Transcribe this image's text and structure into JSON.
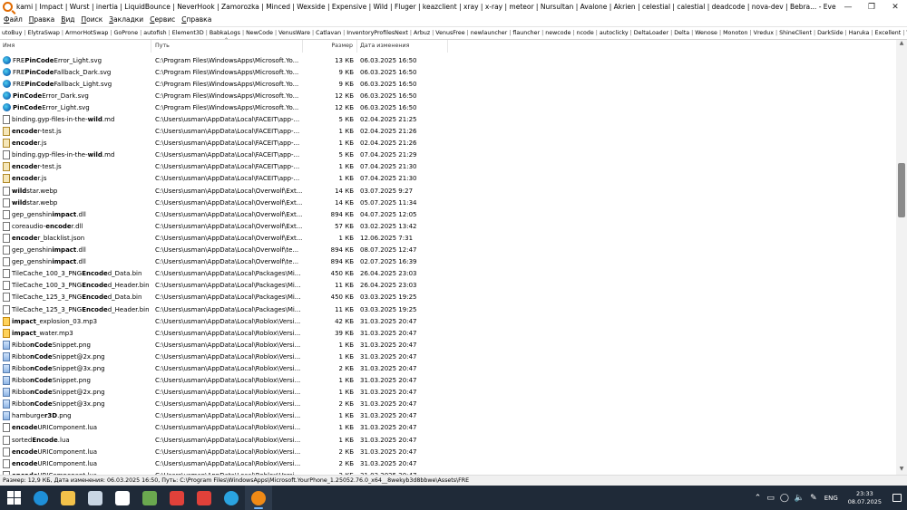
{
  "title": "kami | Impact | Wurst | inertia | LiquidBounce | NeverHook | Zamorozka | Minced | Wexside | Expensive | Wild | Fluger | keazclient | xray | x-ray | meteor | Nursultan | Avalone | Akrien | celestial | calestial | deadcode | nova-dev | Bebra... - Everything",
  "menu": [
    {
      "ul": "Ф",
      "rest": "айл"
    },
    {
      "ul": "П",
      "rest": "равка"
    },
    {
      "ul": "В",
      "rest": "ид"
    },
    {
      "ul": "П",
      "rest": "оиск"
    },
    {
      "ul": "З",
      "rest": "акладки"
    },
    {
      "ul": "С",
      "rest": "ервис"
    },
    {
      "ul": "С",
      "rest": "правка"
    }
  ],
  "bookmarks": [
    "utoBuy",
    "ElytraSwap",
    "ArmorHotSwap",
    "GoProne",
    "autofish",
    "Element3D",
    "BabkaLogs",
    "NewCode",
    "VenusWare",
    "Catlavan",
    "InventoryProfilesNext",
    "Arbuz",
    "VenusFree",
    "newlauncher",
    "flauncher",
    "newcode",
    "ncode",
    "autoclicky",
    "DeltaLoader",
    "Delta",
    "Wenose",
    "Monoton",
    "Vredux",
    "ShineClient",
    "DarkSide",
    "Haruka",
    "Excellent",
    "Venus"
  ],
  "columns": {
    "name": "Имя",
    "path": "Путь",
    "size": "Размер",
    "date": "Дата изменения"
  },
  "files": [
    {
      "icon": "edge",
      "pre": "FRE",
      "bold": "PinCode",
      "post": "Error_Light.svg",
      "path": "C:\\Program Files\\WindowsApps\\Microsoft.Yo...",
      "size": "13 КБ",
      "date": "06.03.2025 16:50"
    },
    {
      "icon": "edge",
      "pre": "FRE",
      "bold": "PinCode",
      "post": "Fallback_Dark.svg",
      "path": "C:\\Program Files\\WindowsApps\\Microsoft.Yo...",
      "size": "9 КБ",
      "date": "06.03.2025 16:50"
    },
    {
      "icon": "edge",
      "pre": "FRE",
      "bold": "PinCode",
      "post": "Fallback_Light.svg",
      "path": "C:\\Program Files\\WindowsApps\\Microsoft.Yo...",
      "size": "9 КБ",
      "date": "06.03.2025 16:50"
    },
    {
      "icon": "edge",
      "pre": "",
      "bold": "PinCode",
      "post": "Error_Dark.svg",
      "path": "C:\\Program Files\\WindowsApps\\Microsoft.Yo...",
      "size": "12 КБ",
      "date": "06.03.2025 16:50"
    },
    {
      "icon": "edge",
      "pre": "",
      "bold": "PinCode",
      "post": "Error_Light.svg",
      "path": "C:\\Program Files\\WindowsApps\\Microsoft.Yo...",
      "size": "12 КБ",
      "date": "06.03.2025 16:50"
    },
    {
      "icon": "doc",
      "pre": "binding.gyp-files-in-the-",
      "bold": "wild",
      "post": ".md",
      "path": "C:\\Users\\usman\\AppData\\Local\\FACEIT\\app-...",
      "size": "5 КБ",
      "date": "02.04.2025 21:25"
    },
    {
      "icon": "js",
      "pre": "",
      "bold": "encode",
      "post": "r-test.js",
      "path": "C:\\Users\\usman\\AppData\\Local\\FACEIT\\app-...",
      "size": "1 КБ",
      "date": "02.04.2025 21:26"
    },
    {
      "icon": "js",
      "pre": "",
      "bold": "encode",
      "post": "r.js",
      "path": "C:\\Users\\usman\\AppData\\Local\\FACEIT\\app-...",
      "size": "1 КБ",
      "date": "02.04.2025 21:26"
    },
    {
      "icon": "doc",
      "pre": "binding.gyp-files-in-the-",
      "bold": "wild",
      "post": ".md",
      "path": "C:\\Users\\usman\\AppData\\Local\\FACEIT\\app-...",
      "size": "5 КБ",
      "date": "07.04.2025 21:29"
    },
    {
      "icon": "js",
      "pre": "",
      "bold": "encode",
      "post": "r-test.js",
      "path": "C:\\Users\\usman\\AppData\\Local\\FACEIT\\app-...",
      "size": "1 КБ",
      "date": "07.04.2025 21:30"
    },
    {
      "icon": "js",
      "pre": "",
      "bold": "encode",
      "post": "r.js",
      "path": "C:\\Users\\usman\\AppData\\Local\\FACEIT\\app-...",
      "size": "1 КБ",
      "date": "07.04.2025 21:30"
    },
    {
      "icon": "doc",
      "pre": "",
      "bold": "wild",
      "post": "star.webp",
      "path": "C:\\Users\\usman\\AppData\\Local\\Overwolf\\Ext...",
      "size": "14 КБ",
      "date": "03.07.2025 9:27"
    },
    {
      "icon": "doc",
      "pre": "",
      "bold": "wild",
      "post": "star.webp",
      "path": "C:\\Users\\usman\\AppData\\Local\\Overwolf\\Ext...",
      "size": "14 КБ",
      "date": "05.07.2025 11:34"
    },
    {
      "icon": "doc",
      "pre": "gep_genshin",
      "bold": "impact",
      "post": ".dll",
      "path": "C:\\Users\\usman\\AppData\\Local\\Overwolf\\Ext...",
      "size": "894 КБ",
      "date": "04.07.2025 12:05"
    },
    {
      "icon": "doc",
      "pre": "coreaudio-",
      "bold": "encode",
      "post": "r.dll",
      "path": "C:\\Users\\usman\\AppData\\Local\\Overwolf\\Ext...",
      "size": "57 КБ",
      "date": "03.02.2025 13:42"
    },
    {
      "icon": "doc",
      "pre": "",
      "bold": "encode",
      "post": "r_blacklist.json",
      "path": "C:\\Users\\usman\\AppData\\Local\\Overwolf\\Ext...",
      "size": "1 КБ",
      "date": "12.06.2025 7:31"
    },
    {
      "icon": "doc",
      "pre": "gep_genshin",
      "bold": "impact",
      "post": ".dll",
      "path": "C:\\Users\\usman\\AppData\\Local\\Overwolf\\te...",
      "size": "894 КБ",
      "date": "08.07.2025 12:47"
    },
    {
      "icon": "doc",
      "pre": "gep_genshin",
      "bold": "impact",
      "post": ".dll",
      "path": "C:\\Users\\usman\\AppData\\Local\\Overwolf\\te...",
      "size": "894 КБ",
      "date": "02.07.2025 16:39"
    },
    {
      "icon": "doc",
      "pre": "TileCache_100_3_PNG",
      "bold": "Encode",
      "post": "d_Data.bin",
      "path": "C:\\Users\\usman\\AppData\\Local\\Packages\\Mi...",
      "size": "450 КБ",
      "date": "26.04.2025 23:03"
    },
    {
      "icon": "doc",
      "pre": "TileCache_100_3_PNG",
      "bold": "Encode",
      "post": "d_Header.bin",
      "path": "C:\\Users\\usman\\AppData\\Local\\Packages\\Mi...",
      "size": "11 КБ",
      "date": "26.04.2025 23:03"
    },
    {
      "icon": "doc",
      "pre": "TileCache_125_3_PNG",
      "bold": "Encode",
      "post": "d_Data.bin",
      "path": "C:\\Users\\usman\\AppData\\Local\\Packages\\Mi...",
      "size": "450 КБ",
      "date": "03.03.2025 19:25"
    },
    {
      "icon": "doc",
      "pre": "TileCache_125_3_PNG",
      "bold": "Encode",
      "post": "d_Header.bin",
      "path": "C:\\Users\\usman\\AppData\\Local\\Packages\\Mi...",
      "size": "11 КБ",
      "date": "03.03.2025 19:25"
    },
    {
      "icon": "mp3",
      "pre": "",
      "bold": "impact",
      "post": "_explosion_03.mp3",
      "path": "C:\\Users\\usman\\AppData\\Local\\Roblox\\Versi...",
      "size": "42 КБ",
      "date": "31.03.2025 20:47"
    },
    {
      "icon": "mp3",
      "pre": "",
      "bold": "impact",
      "post": "_water.mp3",
      "path": "C:\\Users\\usman\\AppData\\Local\\Roblox\\Versi...",
      "size": "39 КБ",
      "date": "31.03.2025 20:47"
    },
    {
      "icon": "png",
      "pre": "Ribbo",
      "bold": "nCode",
      "post": "Snippet.png",
      "path": "C:\\Users\\usman\\AppData\\Local\\Roblox\\Versi...",
      "size": "1 КБ",
      "date": "31.03.2025 20:47"
    },
    {
      "icon": "png",
      "pre": "Ribbo",
      "bold": "nCode",
      "post": "Snippet@2x.png",
      "path": "C:\\Users\\usman\\AppData\\Local\\Roblox\\Versi...",
      "size": "1 КБ",
      "date": "31.03.2025 20:47"
    },
    {
      "icon": "png",
      "pre": "Ribbo",
      "bold": "nCode",
      "post": "Snippet@3x.png",
      "path": "C:\\Users\\usman\\AppData\\Local\\Roblox\\Versi...",
      "size": "2 КБ",
      "date": "31.03.2025 20:47"
    },
    {
      "icon": "png",
      "pre": "Ribbo",
      "bold": "nCode",
      "post": "Snippet.png",
      "path": "C:\\Users\\usman\\AppData\\Local\\Roblox\\Versi...",
      "size": "1 КБ",
      "date": "31.03.2025 20:47"
    },
    {
      "icon": "png",
      "pre": "Ribbo",
      "bold": "nCode",
      "post": "Snippet@2x.png",
      "path": "C:\\Users\\usman\\AppData\\Local\\Roblox\\Versi...",
      "size": "1 КБ",
      "date": "31.03.2025 20:47"
    },
    {
      "icon": "png",
      "pre": "Ribbo",
      "bold": "nCode",
      "post": "Snippet@3x.png",
      "path": "C:\\Users\\usman\\AppData\\Local\\Roblox\\Versi...",
      "size": "2 КБ",
      "date": "31.03.2025 20:47"
    },
    {
      "icon": "png",
      "pre": "hamburge",
      "bold": "r3D",
      "post": ".png",
      "path": "C:\\Users\\usman\\AppData\\Local\\Roblox\\Versi...",
      "size": "1 КБ",
      "date": "31.03.2025 20:47"
    },
    {
      "icon": "doc",
      "pre": "",
      "bold": "encode",
      "post": "URIComponent.lua",
      "path": "C:\\Users\\usman\\AppData\\Local\\Roblox\\Versi...",
      "size": "1 КБ",
      "date": "31.03.2025 20:47"
    },
    {
      "icon": "doc",
      "pre": "sorted",
      "bold": "Encode",
      "post": ".lua",
      "path": "C:\\Users\\usman\\AppData\\Local\\Roblox\\Versi...",
      "size": "1 КБ",
      "date": "31.03.2025 20:47"
    },
    {
      "icon": "doc",
      "pre": "",
      "bold": "encode",
      "post": "URIComponent.lua",
      "path": "C:\\Users\\usman\\AppData\\Local\\Roblox\\Versi...",
      "size": "2 КБ",
      "date": "31.03.2025 20:47"
    },
    {
      "icon": "doc",
      "pre": "",
      "bold": "encode",
      "post": "URIComponent.lua",
      "path": "C:\\Users\\usman\\AppData\\Local\\Roblox\\Versi...",
      "size": "2 КБ",
      "date": "31.03.2025 20:47"
    },
    {
      "icon": "doc",
      "pre": "",
      "bold": "encode",
      "post": "URIComponent.lua",
      "path": "C:\\Users\\usman\\AppData\\Local\\Roblox\\Versi...",
      "size": "2 КБ",
      "date": "31.03.2025 20:47"
    }
  ],
  "status": "Размер: 12,9 КБ, Дата изменения: 06.03.2025 16:50, Путь: C:\\Program Files\\WindowsApps\\Microsoft.YourPhone_1.25052.76.0_x64__8wekyb3d8bbwe\\Assets\\FRE",
  "taskbar": {
    "apps": [
      {
        "name": "edge-icon",
        "color": "#1e8fd8"
      },
      {
        "name": "file-explorer-icon",
        "color": "#f2c14a"
      },
      {
        "name": "steam-icon",
        "color": "#c9d6e3"
      },
      {
        "name": "calendar-app-icon",
        "color": "#ffffff"
      },
      {
        "name": "minecraft-icon",
        "color": "#6aa84f"
      },
      {
        "name": "anydesk-icon",
        "color": "#e0413a"
      },
      {
        "name": "anydesk-icon-2",
        "color": "#e0413a"
      },
      {
        "name": "telegram-icon",
        "color": "#2aa3e0"
      },
      {
        "name": "everything-search-icon",
        "color": "#f08a16"
      }
    ],
    "lang": "ENG",
    "time": "23:33",
    "date": "08.07.2025"
  }
}
